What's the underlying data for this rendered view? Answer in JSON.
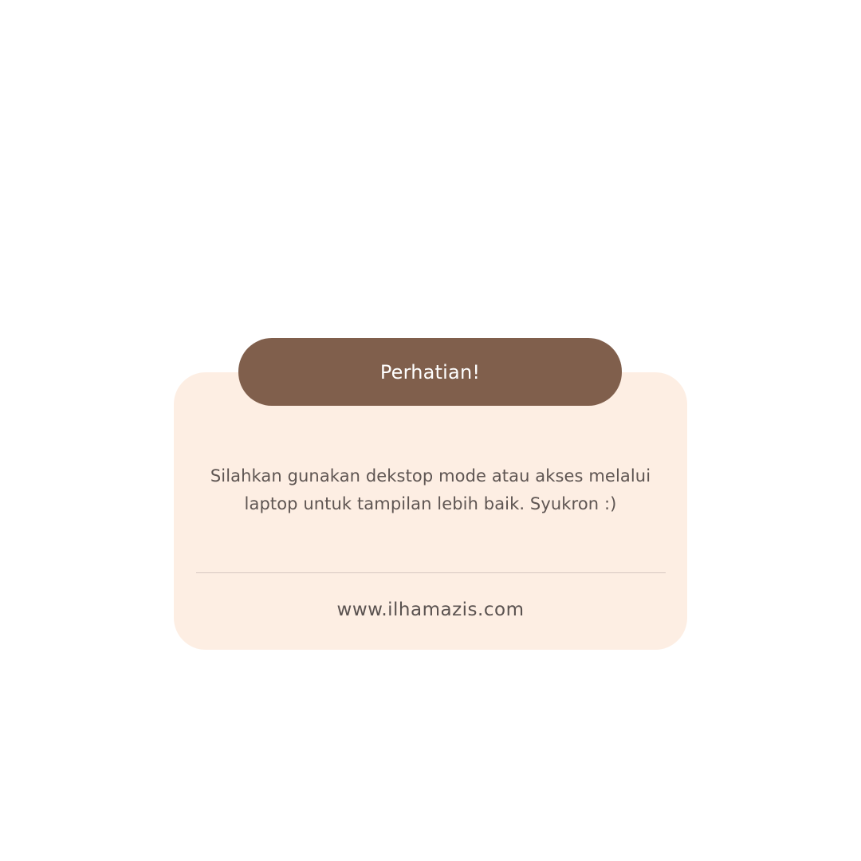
{
  "notice": {
    "title": "Perhatian!",
    "message": "Silahkan gunakan dekstop mode atau akses melalui laptop untuk tampilan lebih baik. Syukron :)",
    "website": "www.ilhamazis.com"
  },
  "colors": {
    "background": "#ffffff",
    "card": "#fdeee3",
    "header": "#805f4c",
    "header_text": "#ffffff",
    "body_text": "#5e5552",
    "divider": "#d6c8c1"
  }
}
